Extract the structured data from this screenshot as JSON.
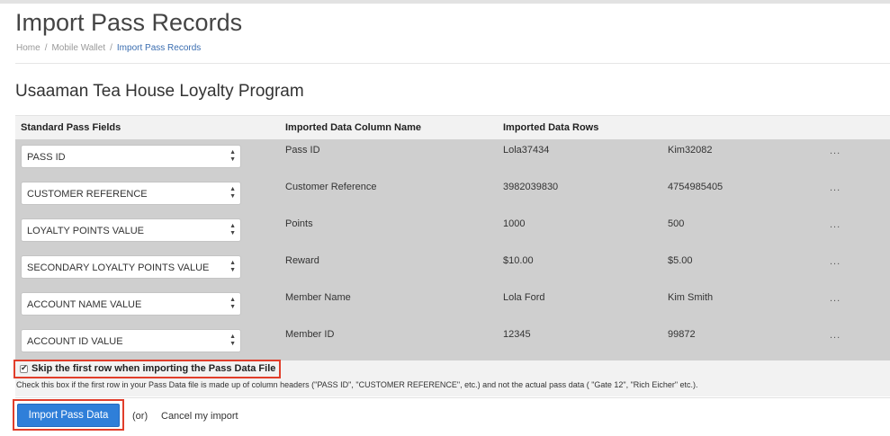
{
  "page": {
    "title": "Import Pass Records",
    "breadcrumb": [
      "Home",
      "Mobile Wallet",
      "Import Pass Records"
    ],
    "breadcrumb_separator": "/"
  },
  "program": {
    "title": "Usaaman Tea House Loyalty Program"
  },
  "table": {
    "headers": {
      "standard_fields": "Standard Pass Fields",
      "column_name": "Imported Data Column Name",
      "data_rows": "Imported Data Rows"
    },
    "more_label": "...",
    "rows": [
      {
        "field": "PASS ID",
        "column": "Pass ID",
        "values": [
          "Lola37434",
          "Kim32082"
        ]
      },
      {
        "field": "CUSTOMER REFERENCE",
        "column": "Customer Reference",
        "values": [
          "3982039830",
          "4754985405"
        ]
      },
      {
        "field": "LOYALTY POINTS VALUE",
        "column": "Points",
        "values": [
          "1000",
          "500"
        ]
      },
      {
        "field": "SECONDARY LOYALTY POINTS VALUE",
        "column": "Reward",
        "values": [
          "$10.00",
          "$5.00"
        ]
      },
      {
        "field": "ACCOUNT NAME VALUE",
        "column": "Member Name",
        "values": [
          "Lola Ford",
          "Kim Smith"
        ]
      },
      {
        "field": "ACCOUNT ID VALUE",
        "column": "Member ID",
        "values": [
          "12345",
          "99872"
        ]
      }
    ]
  },
  "skip_first_row": {
    "checked": true,
    "label": "Skip the first row when importing the Pass Data File",
    "help": "Check this box if the first row in your Pass Data file is made up of column headers (\"PASS ID\", \"CUSTOMER REFERENCE\", etc.) and not the actual pass data ( \"Gate 12\", \"Rich Eicher\" etc.)."
  },
  "actions": {
    "import_label": "Import Pass Data",
    "or_label": "(or)",
    "cancel_label": "Cancel my import"
  },
  "colors": {
    "primary_button": "#2f7fd9",
    "highlight_border": "#e13e2b",
    "grid_body": "#cfcfcf",
    "grid_header": "#f2f2f2",
    "breadcrumb_active": "#3a6db0"
  }
}
